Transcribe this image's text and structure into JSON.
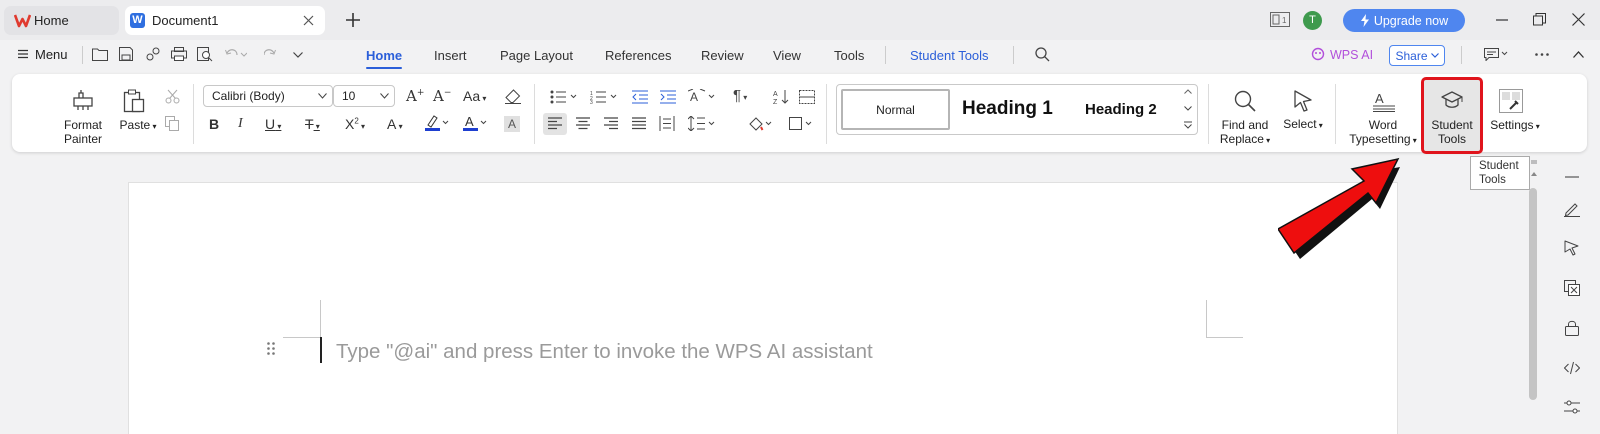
{
  "titlebar": {
    "tabs": [
      {
        "label": "Home"
      },
      {
        "label": "Document1"
      }
    ],
    "avatar_letter": "T",
    "upgrade_label": "Upgrade now"
  },
  "menu": {
    "menu_label": "Menu",
    "tabs": [
      "Home",
      "Insert",
      "Page Layout",
      "References",
      "Review",
      "View",
      "Tools",
      "Student Tools"
    ],
    "active_tab": "Home",
    "wps_ai_label": "WPS AI",
    "share_label": "Share"
  },
  "ribbon": {
    "format_painter_label": "Format Painter",
    "paste_label": "Paste",
    "font_name": "Calibri (Body)",
    "font_size": "10",
    "styles": {
      "normal": "Normal",
      "heading1": "Heading 1",
      "heading2": "Heading 2"
    },
    "find_replace_label": "Find and Replace",
    "select_label": "Select",
    "word_typesetting_label": "Word Typesetting",
    "student_tools_label": "Student Tools",
    "settings_label": "Settings"
  },
  "document": {
    "placeholder": "Type \"@ai\" and press Enter to invoke the WPS AI assistant"
  },
  "tooltip": {
    "text": "Student Tools"
  },
  "colors": {
    "accent": "#2b5fd9",
    "upgrade_bg": "#4f86ef",
    "highlight_red": "#e0141c",
    "avatar_green": "#3e9a4d"
  }
}
